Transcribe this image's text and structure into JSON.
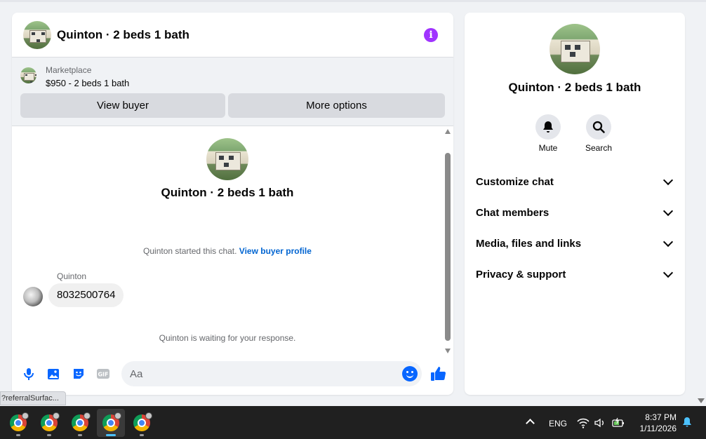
{
  "chat": {
    "title": "Quinton · 2 beds 1 bath",
    "info_icon": "info-icon",
    "marketplace": {
      "label": "Marketplace",
      "listing": "$950 - 2 beds 1 bath",
      "view_buyer": "View buyer",
      "more_options": "More options"
    },
    "conversation": {
      "title": "Quinton · 2 beds 1 bath",
      "started_text": "Quinton started this chat.",
      "started_link": "View buyer profile",
      "sender": "Quinton",
      "message": "8032500764",
      "waiting": "Quinton is waiting for your response."
    },
    "composer": {
      "placeholder": "Aa",
      "gif_label": "GIF"
    },
    "accent_color": "#0866ff"
  },
  "url_tooltip": "?referralSurfac...",
  "info_panel": {
    "title": "Quinton · 2 beds 1 bath",
    "actions": [
      {
        "label": "Mute",
        "icon": "bell-icon"
      },
      {
        "label": "Search",
        "icon": "search-icon"
      }
    ],
    "sections": [
      {
        "label": "Customize chat"
      },
      {
        "label": "Chat members"
      },
      {
        "label": "Media, files and links"
      },
      {
        "label": "Privacy & support"
      }
    ]
  },
  "taskbar": {
    "apps": [
      "chrome-icon",
      "chrome-icon",
      "chrome-icon",
      "chrome-icon",
      "chrome-icon"
    ],
    "active_index": 3,
    "language": "ENG",
    "time": "8:37 PM",
    "date": "1/11/2026"
  }
}
